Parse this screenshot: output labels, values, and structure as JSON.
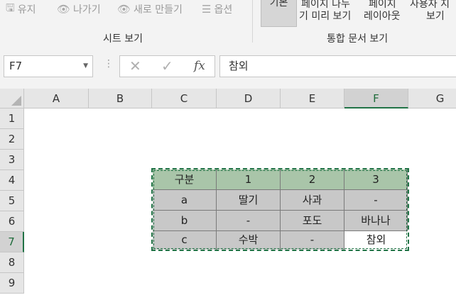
{
  "ribbon": {
    "items": [
      {
        "label": "유지",
        "icon": "save-icon",
        "glyph": "🖫"
      },
      {
        "label": "나가기",
        "icon": "eye-exit-icon",
        "glyph": "👁"
      },
      {
        "label": "새로 만들기",
        "icon": "eye-new-icon",
        "glyph": "👁"
      },
      {
        "label": "옵션",
        "icon": "list-options-icon",
        "glyph": "☰"
      }
    ],
    "group_sheet_view": "시트 보기",
    "group_workbook_views": "통합 문서 보기",
    "normal_button": "기본",
    "page_break_top": "페이지 나누",
    "page_break_bottom": "기 미리 보기",
    "page_layout_top": "페이지",
    "page_layout_bottom": "레이아웃",
    "custom_top": "사용자 지",
    "custom_bottom": "보기"
  },
  "formula_bar": {
    "name_box": "F7",
    "cancel_glyph": "✕",
    "enter_glyph": "✓",
    "fx_label": "fx",
    "value": "참외"
  },
  "grid": {
    "columns": [
      "A",
      "B",
      "C",
      "D",
      "E",
      "F",
      "G"
    ],
    "rows": [
      "1",
      "2",
      "3",
      "4",
      "5",
      "6",
      "7",
      "8",
      "9"
    ],
    "selected_column": "F",
    "selected_row": "7",
    "table": [
      [
        "구분",
        "1",
        "2",
        "3"
      ],
      [
        "a",
        "딸기",
        "사과",
        "-"
      ],
      [
        "b",
        "-",
        "포도",
        "바나나"
      ],
      [
        "c",
        "수박",
        "-",
        "참외"
      ]
    ],
    "colors": {
      "header_fill": "#a9c5a9",
      "body_fill": "#c8c8c8",
      "selection": "#217346"
    }
  }
}
